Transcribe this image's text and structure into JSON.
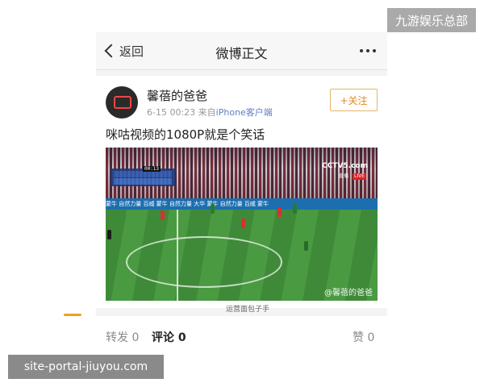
{
  "header": {
    "back_label": "返回",
    "title": "微博正文"
  },
  "post": {
    "username": "馨蓓的爸爸",
    "time": "6-15 00:23",
    "source_prefix": "来自",
    "source_name": "iPhone客户端",
    "follow_label": "+关注",
    "text": "咪咕视频的1080P就是个笑话",
    "video": {
      "channel": "CCTV5.com",
      "broadcast_label": "直播",
      "live_label": "LIVE",
      "match_time": "00:13",
      "watermark": "@馨蓓的爸爸",
      "adboard_text": "蒙牛  自然力量  百威  蒙牛  自然力量  大华  蒙牛  自然力量  百威  蒙牛"
    }
  },
  "actions": {
    "repost_label": "转发",
    "repost_count": "0",
    "comment_label": "评论",
    "comment_count": "0",
    "like_label": "赞",
    "like_count": "0"
  },
  "overlays": {
    "corner_badge": "九游娱乐总部",
    "site_badge": "site-portal-jiuyou.com",
    "qr_watermark": "运营面包子手"
  },
  "colors": {
    "follow_accent": "#e08a22",
    "tab_indicator": "#f0a020",
    "source_link": "#5d7ec0"
  }
}
